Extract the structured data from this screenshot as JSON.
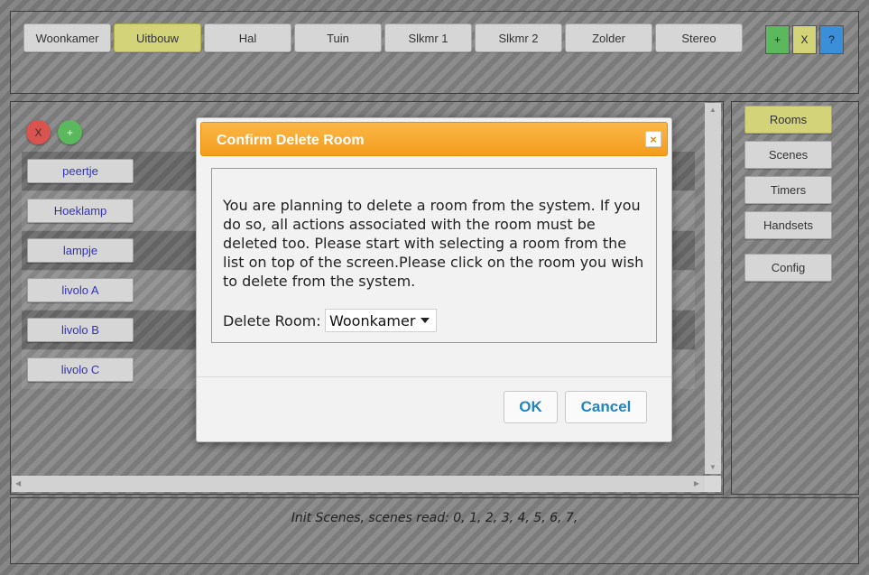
{
  "rooms": [
    "Woonkamer",
    "Uitbouw",
    "Hal",
    "Tuin",
    "Slkmr 1",
    "Slkmr 2",
    "Zolder",
    "Stereo"
  ],
  "active_room_index": 1,
  "top_buttons": {
    "add": "+",
    "remove": "X",
    "help": "?"
  },
  "room_controls": {
    "delete": "X",
    "add": "+"
  },
  "devices": [
    "peertje",
    "Hoeklamp",
    "lampje",
    "livolo A",
    "livolo B",
    "livolo C"
  ],
  "sidebar": {
    "items": [
      "Rooms",
      "Scenes",
      "Timers",
      "Handsets",
      "Config"
    ],
    "active_index": 0
  },
  "status": "Init Scenes, scenes read: 0, 1, 2, 3, 4, 5, 6, 7,",
  "dialog": {
    "title": "Confirm Delete Room",
    "close": "×",
    "message": "You are planning to delete a room from the system. If you do so, all actions associated with the room must be deleted too. Please start with selecting a room from the list on top of the screen.Please click on the room you wish to delete from the system.",
    "select_label": "Delete Room:",
    "selected_room": "Woonkamer",
    "ok": "OK",
    "cancel": "Cancel"
  },
  "colors": {
    "active_tab": "#d3d37a",
    "dialog_header": "#f39c1c",
    "add_button": "#5cb85c",
    "delete_button": "#d9534f",
    "help_button": "#3a8fd8",
    "device_text": "#3333bb",
    "dialog_button_text": "#1f86c1"
  }
}
